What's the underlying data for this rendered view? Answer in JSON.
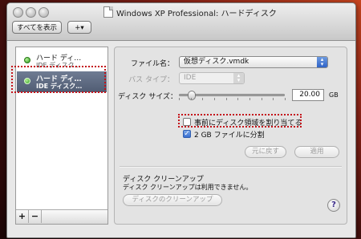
{
  "window": {
    "title": "Windows XP Professional: ハードディスク"
  },
  "toolbar": {
    "show_all_label": "すべてを表示",
    "add_menu_label": "+▾"
  },
  "sidebar": {
    "items": [
      {
        "name": "ハード ディ…",
        "type": "IDE ディスク…",
        "selected": false
      },
      {
        "name": "ハード ディ…",
        "type": "IDE ディスク…",
        "selected": true
      }
    ],
    "add_label": "+",
    "remove_label": "−"
  },
  "panel": {
    "file_name_label": "ファイル名：",
    "file_name_value": "仮想ディスク.vmdk",
    "bus_type_label": "バス タイプ：",
    "bus_type_value": "IDE",
    "disk_size_label": "ディスク サイズ：",
    "disk_size_value": "20.00",
    "disk_size_unit": "GB",
    "disk_size_slider_fraction": 0.12,
    "preallocate_label": "事前にディスク領域を割り当てる",
    "preallocate_checked": false,
    "split_label": "2 GB ファイルに分割",
    "split_checked": true,
    "revert_label": "元に戻す",
    "apply_label": "適用",
    "cleanup_title": "ディスク クリーンアップ",
    "cleanup_status": "ディスク クリーンアップは利用できません。",
    "cleanup_button_label": "ディスクのクリーンアップ",
    "help_label": "?"
  },
  "annotation_color": "#c4131a"
}
